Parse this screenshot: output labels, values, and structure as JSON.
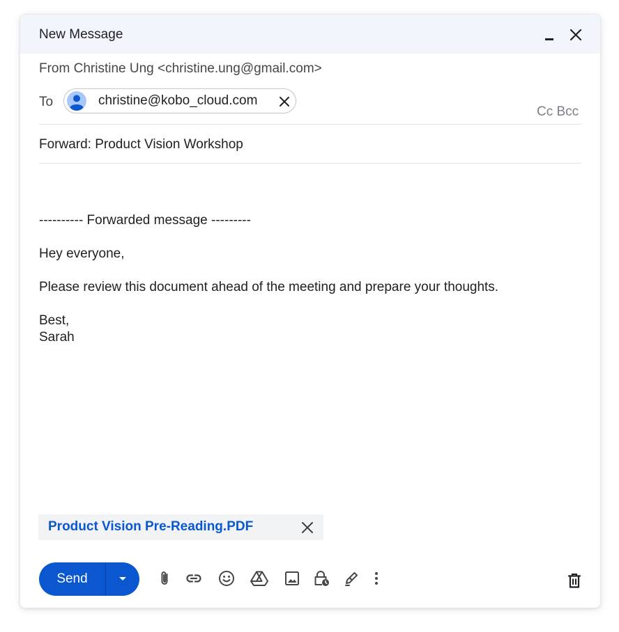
{
  "window": {
    "title": "New Message"
  },
  "header": {
    "from_line": "From Christine Ung <christine.ung@gmail.com>",
    "to_label": "To",
    "recipient": {
      "email": "christine@kobo_cloud.com"
    },
    "cc_bcc_label": "Cc Bcc",
    "subject": "Forward: Product Vision Workshop"
  },
  "body": {
    "forward_marker": "---------- Forwarded message ---------",
    "greeting": "Hey everyone,",
    "message": "Please review this document ahead of the meeting and prepare your thoughts.",
    "signoff": "Best,",
    "signature": "Sarah"
  },
  "attachment": {
    "name": "Product Vision Pre-Reading.PDF"
  },
  "toolbar": {
    "send_label": "Send",
    "tools": [
      "attach-file-icon",
      "insert-link-icon",
      "insert-emoji-icon",
      "google-drive-icon",
      "insert-photo-icon",
      "confidential-mode-icon",
      "signature-pen-icon",
      "more-options-icon"
    ],
    "discard": "trash-icon"
  },
  "colors": {
    "accent": "#0b57d0",
    "titlebar_bg": "#f2f6fc",
    "attachment_bg": "#f1f3f4",
    "muted_text": "#7b7f86"
  }
}
